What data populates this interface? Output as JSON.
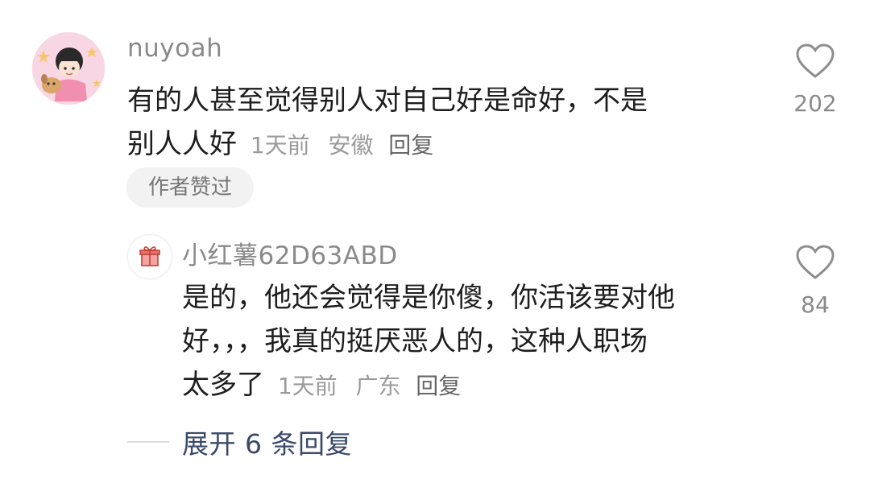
{
  "comment": {
    "username": "nuyoah",
    "text_line1": "有的人甚至觉得别人对自己好是命好，不是",
    "text_line2": "别人人好",
    "time": "1天前",
    "location": "安徽",
    "reply_label": "回复",
    "badge": "作者赞过",
    "like_count": "202"
  },
  "reply": {
    "username": "小红薯62D63ABD",
    "text_line1": "是的，他还会觉得是你傻，你活该要对他",
    "text_line2": "好，，，我真的挺厌恶人的，这种人职场",
    "text_line3": "太多了",
    "time": "1天前",
    "location": "广东",
    "reply_label": "回复",
    "like_count": "84"
  },
  "expand_replies": "展开 6 条回复",
  "icons": {
    "like": "heart-outline-icon",
    "gift": "gift-icon"
  },
  "colors": {
    "accent_link": "#3b4a69",
    "muted": "#9a9a9a"
  }
}
